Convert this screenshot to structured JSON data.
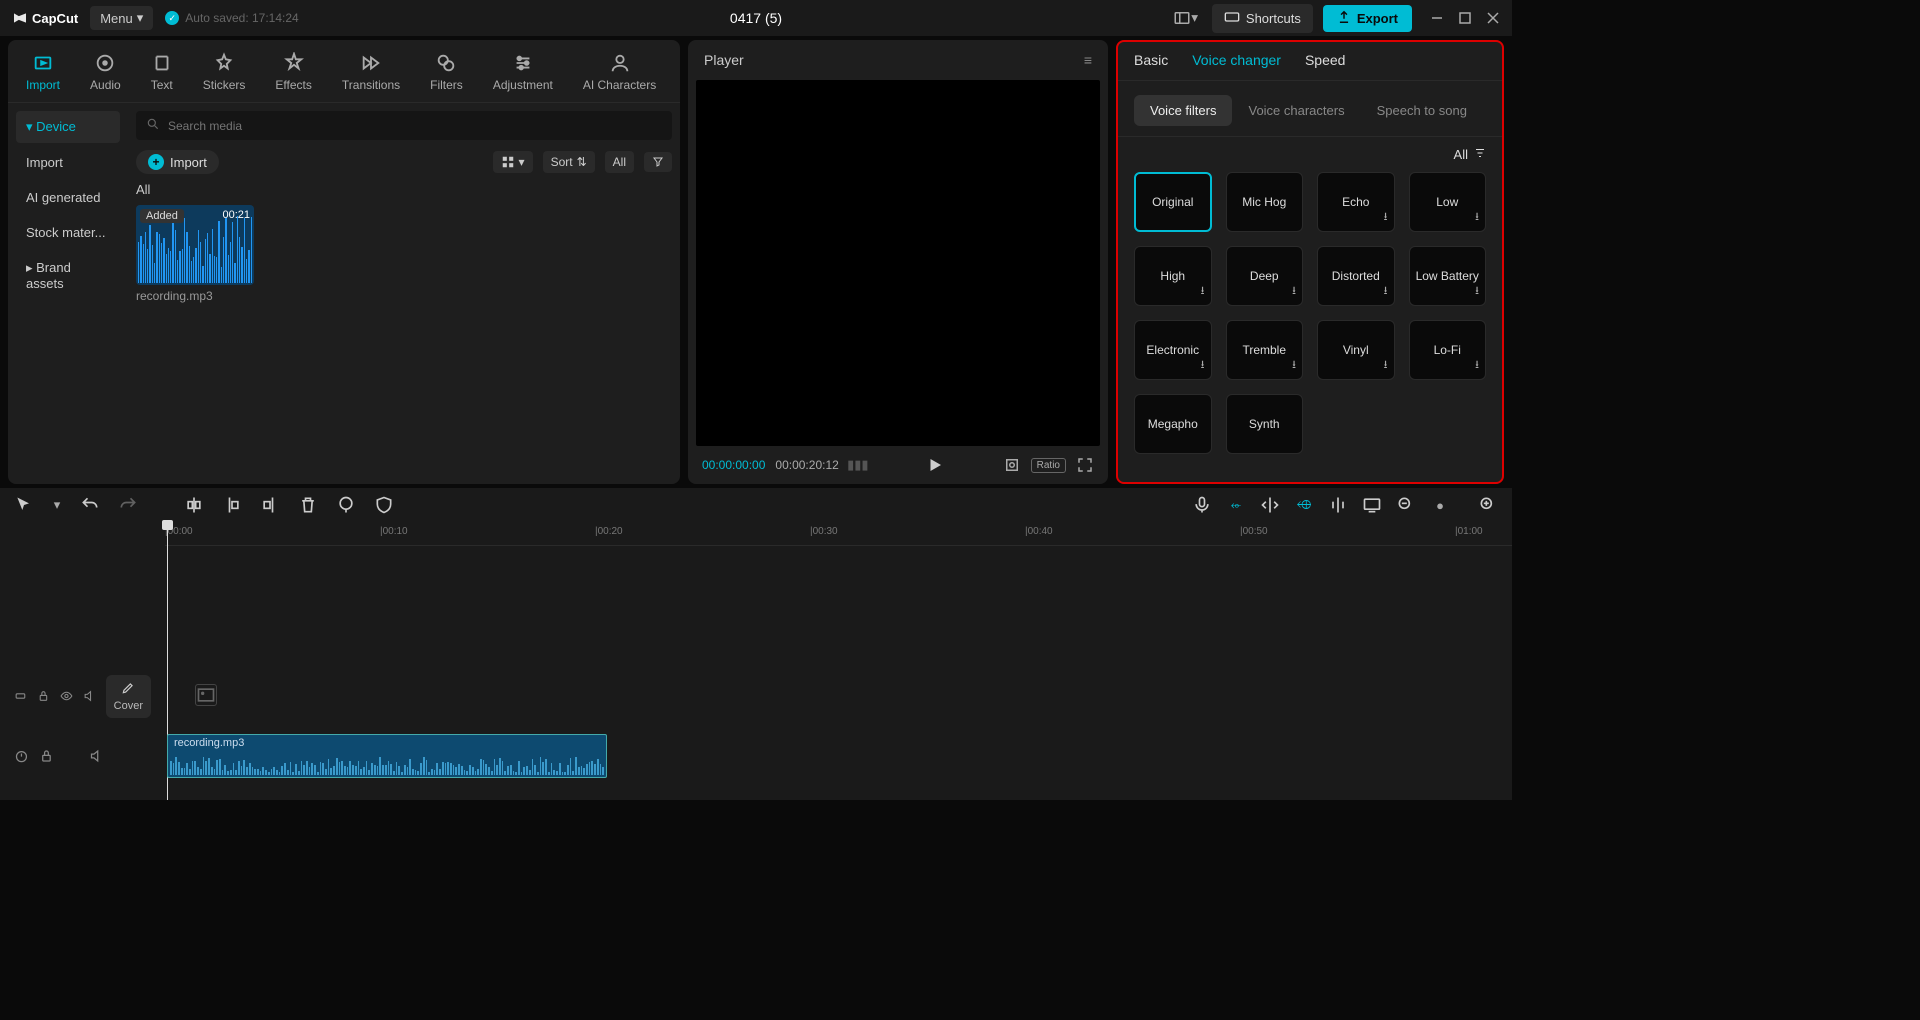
{
  "app": {
    "name": "CapCut",
    "menu_label": "Menu",
    "autosave": "Auto saved: 17:14:24",
    "project_title": "0417 (5)",
    "shortcuts_label": "Shortcuts",
    "export_label": "Export"
  },
  "nav_tabs": [
    {
      "label": "Import",
      "active": true
    },
    {
      "label": "Audio",
      "active": false
    },
    {
      "label": "Text",
      "active": false
    },
    {
      "label": "Stickers",
      "active": false
    },
    {
      "label": "Effects",
      "active": false
    },
    {
      "label": "Transitions",
      "active": false
    },
    {
      "label": "Filters",
      "active": false
    },
    {
      "label": "Adjustment",
      "active": false
    },
    {
      "label": "AI Characters",
      "active": false
    }
  ],
  "side_items": [
    {
      "label": "Device",
      "active": true,
      "caret": true
    },
    {
      "label": "Import",
      "active": false
    },
    {
      "label": "AI generated",
      "active": false
    },
    {
      "label": "Stock mater...",
      "active": false
    },
    {
      "label": "Brand assets",
      "active": false,
      "caret_left": true
    }
  ],
  "media": {
    "search_placeholder": "Search media",
    "import_label": "Import",
    "sort_label": "Sort",
    "all_label": "All",
    "filter_all": "All",
    "items": [
      {
        "name": "recording.mp3",
        "added_badge": "Added",
        "duration": "00:21"
      }
    ]
  },
  "player": {
    "title": "Player",
    "current_time": "00:00:00:00",
    "duration": "00:00:20:12",
    "ratio_label": "Ratio"
  },
  "inspector": {
    "tabs": [
      {
        "label": "Basic",
        "active": false
      },
      {
        "label": "Voice changer",
        "active": true
      },
      {
        "label": "Speed",
        "active": false
      }
    ],
    "subtabs": [
      {
        "label": "Voice filters",
        "active": true
      },
      {
        "label": "Voice characters",
        "active": false
      },
      {
        "label": "Speech to song",
        "active": false
      }
    ],
    "all_label": "All",
    "filters": [
      {
        "label": "Original",
        "selected": true,
        "download": false
      },
      {
        "label": "Mic Hog",
        "selected": false,
        "download": false
      },
      {
        "label": "Echo",
        "selected": false,
        "download": true
      },
      {
        "label": "Low",
        "selected": false,
        "download": true
      },
      {
        "label": "High",
        "selected": false,
        "download": true
      },
      {
        "label": "Deep",
        "selected": false,
        "download": true
      },
      {
        "label": "Distorted",
        "selected": false,
        "download": true
      },
      {
        "label": "Low Battery",
        "selected": false,
        "download": true
      },
      {
        "label": "Electronic",
        "selected": false,
        "download": true
      },
      {
        "label": "Tremble",
        "selected": false,
        "download": true
      },
      {
        "label": "Vinyl",
        "selected": false,
        "download": true
      },
      {
        "label": "Lo-Fi",
        "selected": false,
        "download": true
      },
      {
        "label": "Megapho",
        "selected": false,
        "download": false
      },
      {
        "label": "Synth",
        "selected": false,
        "download": false
      }
    ]
  },
  "timeline": {
    "ticks": [
      "00:00",
      "00:10",
      "00:20",
      "00:30",
      "00:40",
      "00:50",
      "01:00"
    ],
    "cover_label": "Cover",
    "audio_clip_name": "recording.mp3"
  }
}
